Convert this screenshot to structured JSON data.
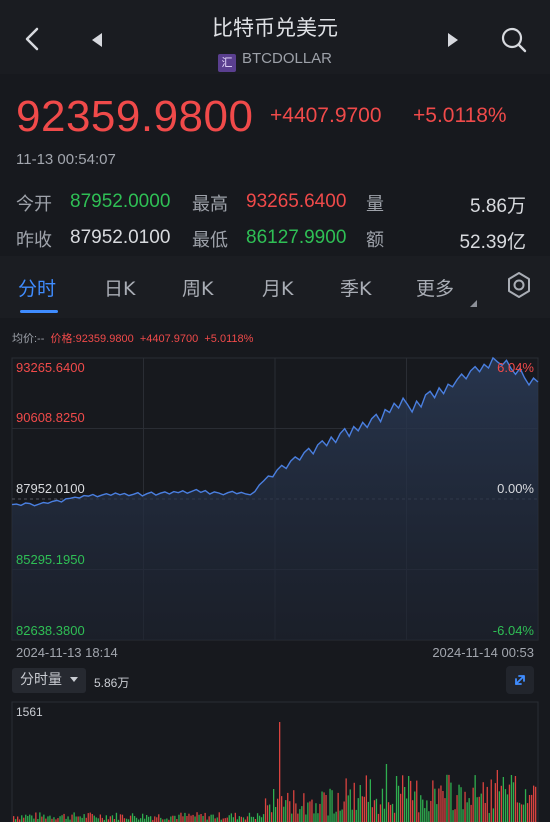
{
  "header": {
    "title": "比特币兑美元",
    "badge": "汇",
    "symbol": "BTCDOLLAR"
  },
  "quote": {
    "price": "92359.9800",
    "change": "+4407.9700",
    "change_pct": "+5.0118%",
    "time": "11-13 00:54:07",
    "open_label": "今开",
    "open": "87952.0000",
    "high_label": "最高",
    "high": "93265.6400",
    "vol_label": "量",
    "vol": "5.86万",
    "prev_label": "昨收",
    "prev": "87952.0100",
    "low_label": "最低",
    "low": "86127.9900",
    "amt_label": "额",
    "amt": "52.39亿"
  },
  "tabs": [
    "分时",
    "日K",
    "周K",
    "月K",
    "季K",
    "更多"
  ],
  "legend": {
    "avg": "均价:--",
    "price": "价格:92359.9800",
    "change": "+4407.9700",
    "pct": "+5.0118%"
  },
  "chart_data": {
    "type": "line",
    "y_ticks": [
      "93265.6400",
      "90608.8250",
      "87952.0100",
      "85295.1950",
      "82638.3800"
    ],
    "pct_ticks": [
      "6.04%",
      "0.00%",
      "-6.04%"
    ],
    "x_start": "2024-11-13 18:14",
    "x_end": "2024-11-14 00:53",
    "ylim": [
      82638.38,
      93265.64
    ],
    "values": [
      87740,
      87760,
      87710,
      87800,
      87780,
      87700,
      87760,
      87820,
      87790,
      87860,
      87900,
      87840,
      87960,
      87980,
      88020,
      87990,
      88080,
      88060,
      88120,
      88040,
      88100,
      88150,
      88090,
      88180,
      88110,
      88160,
      88080,
      88130,
      88190,
      88070,
      88150,
      88210,
      88100,
      88170,
      88220,
      88140,
      88230,
      88190,
      88260,
      88170,
      88240,
      88310,
      88200,
      88270,
      88140,
      88220,
      88180,
      88110,
      88190,
      88240,
      88150,
      88200,
      88140,
      88110,
      88230,
      88480,
      88640,
      88820,
      88790,
      89050,
      89220,
      89100,
      89380,
      89540,
      89420,
      89700,
      89860,
      89650,
      89990,
      90140,
      89960,
      90290,
      90080,
      90420,
      90600,
      90310,
      90680,
      90520,
      90840,
      90650,
      90980,
      91140,
      90870,
      91320,
      91210,
      91560,
      91380,
      91750,
      91510,
      91230,
      91640,
      91420,
      91880,
      92010,
      91770,
      92140,
      91920,
      92280,
      92180,
      92450,
      92660,
      92480,
      92780,
      92940,
      92750,
      93030,
      92890,
      93270,
      93120,
      92990,
      93180,
      92870,
      92650,
      92880,
      92520,
      92250,
      92510,
      92360
    ],
    "volume": {
      "max_label": "1561",
      "total_label": "5.86万",
      "selector": "分时量"
    }
  },
  "colors": {
    "up": "#f04a4a",
    "down": "#2fbf55",
    "line": "#4a7fe0",
    "accent": "#3f8cff"
  }
}
